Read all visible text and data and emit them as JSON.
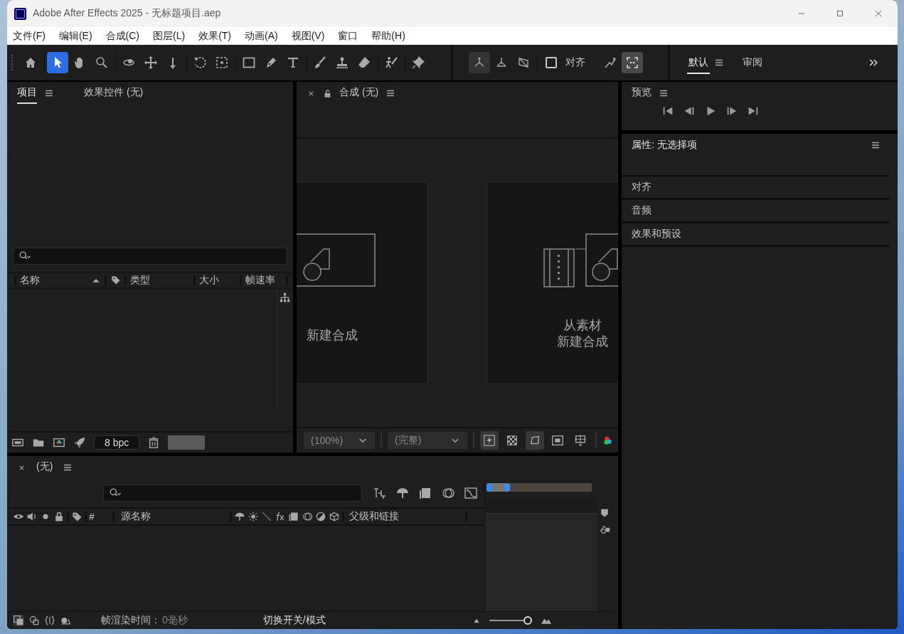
{
  "window": {
    "title": "Adobe After Effects 2025 - 无标题项目.aep"
  },
  "menu": [
    "文件(F)",
    "编辑(E)",
    "合成(C)",
    "图层(L)",
    "效果(T)",
    "动画(A)",
    "视图(V)",
    "窗口",
    "帮助(H)"
  ],
  "toolbar": {
    "tools": [
      {
        "selected": false
      },
      {
        "selected": true
      },
      {
        "selected": false
      },
      {
        "selected": false
      },
      {
        "selected": false
      },
      {
        "selected": false
      },
      {
        "selected": false
      },
      {
        "selected": false
      },
      {
        "selected": false
      },
      {
        "selected": false
      },
      {
        "selected": false
      },
      {
        "selected": false
      },
      {
        "selected": false
      },
      {
        "selected": false
      },
      {
        "selected": false
      },
      {
        "selected": false
      },
      {
        "selected": false
      }
    ],
    "axis_modes": [
      {
        "selected": true
      },
      {
        "selected": false
      },
      {
        "selected": false
      }
    ],
    "snap": {
      "label": "对齐",
      "checked": false
    },
    "snap_options_on": true
  },
  "workspaces": [
    {
      "label": "默认",
      "selected": true
    },
    {
      "label": "审阅",
      "selected": false
    }
  ],
  "project_panel": {
    "tabs": [
      {
        "label": "项目",
        "selected": true
      },
      {
        "label": "效果控件 (无)",
        "selected": false
      }
    ],
    "columns": [
      "名称",
      "类型",
      "大小",
      "帧速率"
    ],
    "bit_depth": "8 bpc"
  },
  "comp_panel": {
    "tab": "合成 (无)",
    "cards": [
      {
        "lines": [
          "新建合成"
        ],
        "kind": "comp"
      },
      {
        "lines": [
          "从素材",
          "新建合成"
        ],
        "kind": "footage"
      }
    ],
    "magnification": "(100%)",
    "resolution": "(完整)",
    "viewer_toggles": [
      {
        "on": true
      },
      {
        "on": false
      },
      {
        "on": true
      },
      {
        "on": false
      },
      {
        "on": false
      }
    ]
  },
  "timeline": {
    "tab": "(无)",
    "columns": [
      "#",
      "源名称",
      "父级和链接"
    ],
    "render_time_label": "帧渲染时间：",
    "render_time": "0毫秒",
    "toggle_label": "切换开关/模式",
    "zoom": {
      "level": 0.9
    }
  },
  "right": {
    "preview": {
      "title": "预览"
    },
    "properties": {
      "title": "属性: 无选择项"
    },
    "sections": [
      "对齐",
      "音频",
      "效果和预设"
    ]
  }
}
